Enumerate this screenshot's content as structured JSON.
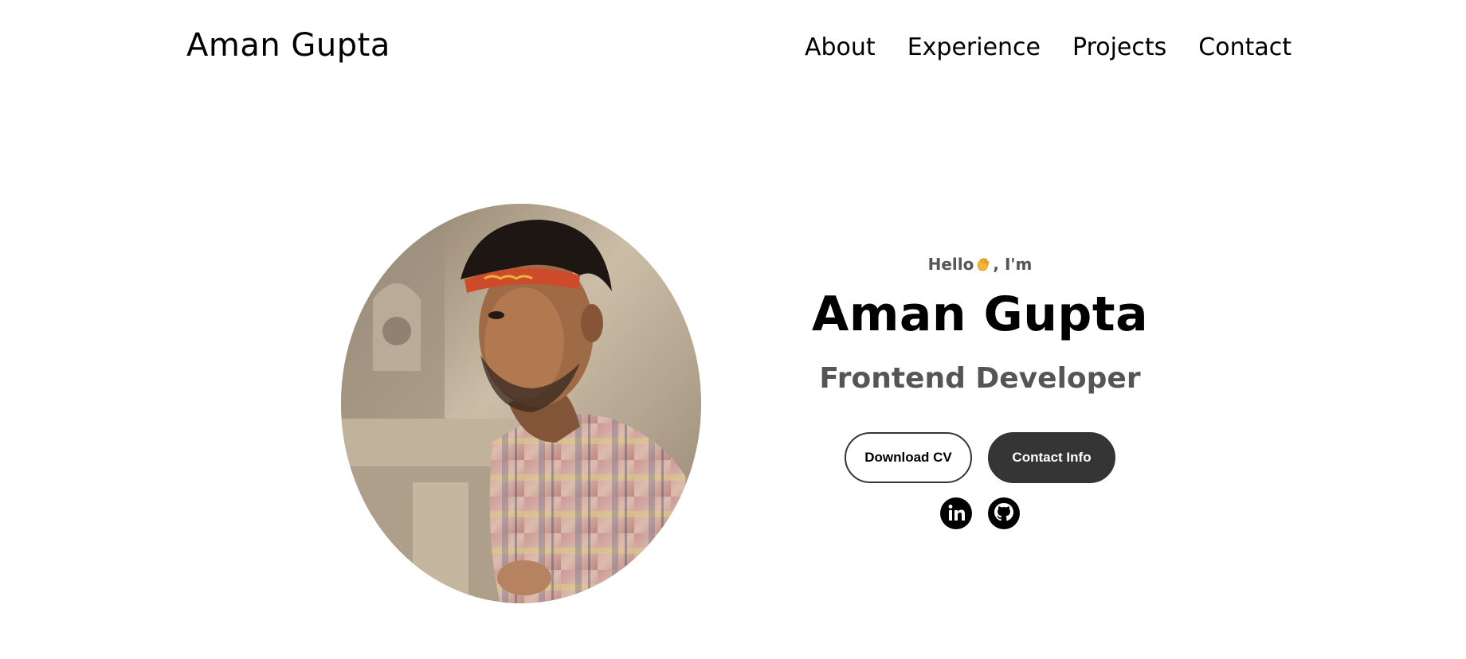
{
  "nav": {
    "logo": "Aman Gupta",
    "links": [
      "About",
      "Experience",
      "Projects",
      "Contact"
    ]
  },
  "hero": {
    "greeting_prefix": "Hello",
    "greeting_icon": "waving-hand-icon",
    "greeting_suffix": ", I'm",
    "name": "Aman Gupta",
    "role": "Frontend Developer",
    "buttons": {
      "download_cv": "Download CV",
      "contact_info": "Contact Info"
    },
    "social_icons": [
      "linkedin-icon",
      "github-icon"
    ]
  },
  "colors": {
    "text_dark": "#000000",
    "text_muted": "#555555",
    "button_dark": "#353535",
    "background": "#ffffff"
  }
}
